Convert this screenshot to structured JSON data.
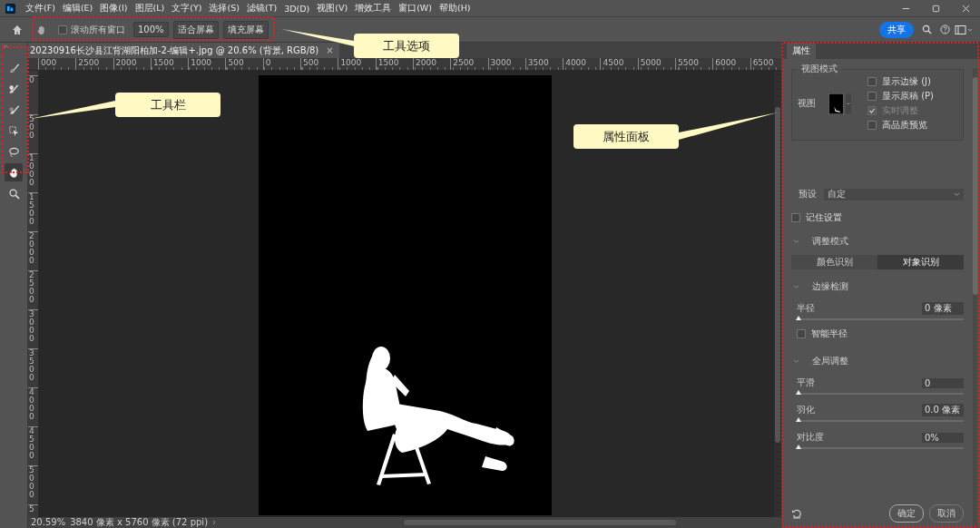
{
  "menu": [
    "文件(F)",
    "编辑(E)",
    "图像(I)",
    "图层(L)",
    "文字(Y)",
    "选择(S)",
    "滤镜(T)",
    "3D(D)",
    "视图(V)",
    "增效工具",
    "窗口(W)",
    "帮助(H)"
  ],
  "options": {
    "scroll_all": {
      "label": "滚动所有窗口",
      "checked": false
    },
    "buttons": [
      "100%",
      "适合屏幕",
      "填充屏幕"
    ]
  },
  "share_button": "共享",
  "document_tab": {
    "title": "20230916长沙县江背湖阳柏加-2-编辑+.jpg @ 20.6% (背景, RGB/8)",
    "close": "×"
  },
  "ruler_h": [
    "000",
    "2500",
    "2000",
    "1500",
    "1000",
    "500",
    "0",
    "500",
    "1000",
    "1500",
    "2000",
    "2500",
    "3000",
    "3500",
    "4000",
    "4500",
    "5000",
    "5500",
    "6000",
    "6500"
  ],
  "ruler_v": [
    "0",
    "500",
    "1000",
    "1500",
    "2000",
    "2500",
    "3000",
    "3500",
    "4000",
    "4500",
    "5000",
    "5"
  ],
  "tools": [
    {
      "kind": "brush",
      "selected": false
    },
    {
      "kind": "brush-plus",
      "selected": false
    },
    {
      "kind": "brush-soft",
      "selected": false
    },
    {
      "kind": "object-select",
      "selected": false
    },
    {
      "kind": "lasso",
      "selected": false
    },
    {
      "kind": "hand",
      "selected": true
    },
    {
      "kind": "zoom",
      "selected": false
    }
  ],
  "status": {
    "zoom": "20.59%",
    "info": "3840 像素 x 5760 像素 (72 ppi)",
    "arrow": "›"
  },
  "panel": {
    "tab": "属性",
    "view_mode": {
      "legend": "视图模式",
      "view_label": "视图",
      "options": [
        {
          "label": "显示边缘 (J)",
          "checked": false,
          "disabled": false
        },
        {
          "label": "显示原稿 (P)",
          "checked": false,
          "disabled": false
        },
        {
          "label": "实时调整",
          "checked": true,
          "disabled": true
        },
        {
          "label": "高品质预览",
          "checked": false,
          "disabled": false
        }
      ]
    },
    "preset": {
      "label": "预设",
      "value": "自定"
    },
    "remember": {
      "label": "记住设置",
      "checked": false
    },
    "sections": [
      {
        "title": "调整模式",
        "expanded": true,
        "segments": [
          {
            "label": "颜色识别",
            "selected": false
          },
          {
            "label": "对象识别",
            "selected": true
          }
        ]
      },
      {
        "title": "边缘检测",
        "expanded": true,
        "sliders": [
          {
            "label": "半径",
            "value": "0 像素",
            "level": 0
          }
        ],
        "checkbox": {
          "label": "智能半径",
          "checked": false
        }
      },
      {
        "title": "全局调整",
        "expanded": true,
        "sliders": [
          {
            "label": "平滑",
            "value": "0",
            "level": 0
          },
          {
            "label": "羽化",
            "value": "0.0 像素",
            "level": 0
          },
          {
            "label": "对比度",
            "value": "0%",
            "level": 0
          }
        ]
      }
    ],
    "buttons": [
      "确定",
      "取消"
    ]
  },
  "callouts": [
    {
      "label": "工具选项"
    },
    {
      "label": "工具栏"
    },
    {
      "label": "属性面板"
    }
  ]
}
